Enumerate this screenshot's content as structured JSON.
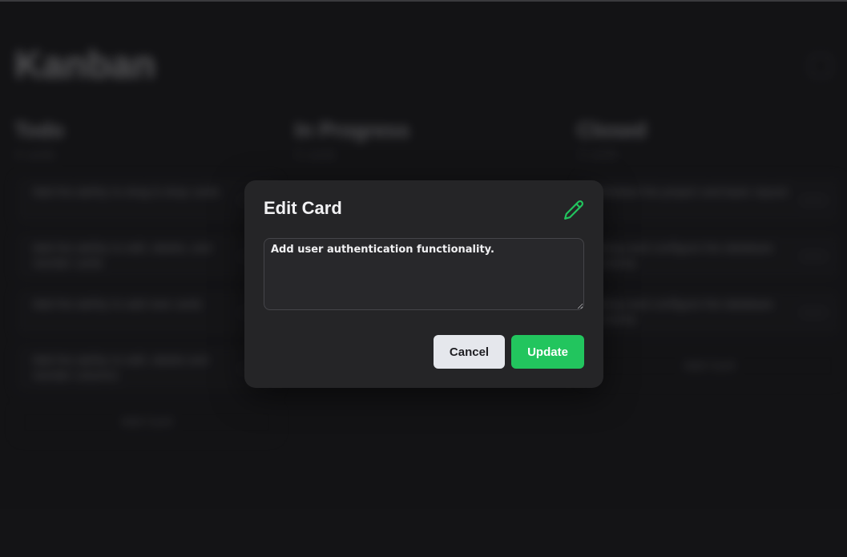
{
  "app": {
    "title": "Kanban"
  },
  "board": {
    "columns": [
      {
        "title": "Todo",
        "count": "4 cards",
        "cards": [
          "Add the ability to drag & drop cards",
          "Add the ability to edit, delete, and reorder cards",
          "Add the ability to add new cards",
          "Add the ability to edit, delete and reorder columns"
        ],
        "add_label": "Add Card"
      },
      {
        "title": "In Progress",
        "count": "0 cards",
        "cards": [],
        "add_label": ""
      },
      {
        "title": "Closed",
        "count": "3 cards",
        "cards": [
          "Initialise the project and basic layout",
          "Setup and configure the database schema",
          "Setup and configure the database schema"
        ],
        "add_label": "Add Card"
      }
    ]
  },
  "modal": {
    "title": "Edit Card",
    "textarea_value": "Add user authentication functionality.",
    "cancel_label": "Cancel",
    "update_label": "Update",
    "icon": "pencil-icon"
  },
  "colors": {
    "background": "#19191b",
    "modal_bg": "#252527",
    "accent": "#22c55e",
    "cancel_bg": "#e5e7ec"
  }
}
